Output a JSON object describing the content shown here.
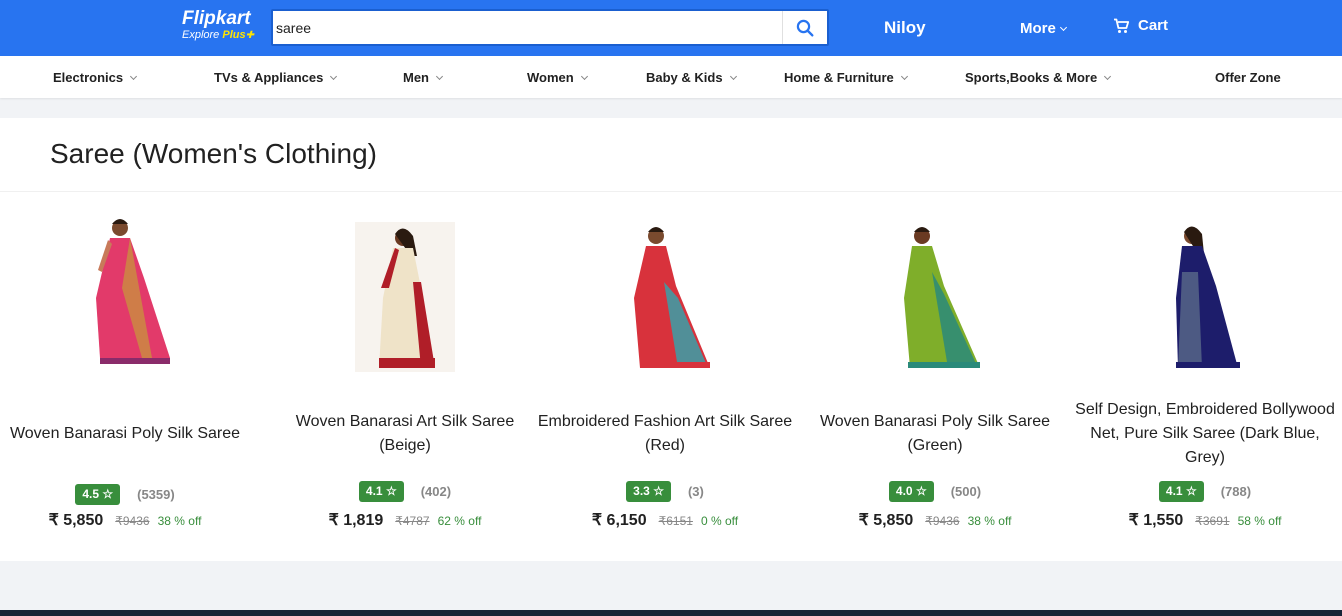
{
  "header": {
    "logo_text": "Flipkart",
    "logo_sub": "Explore",
    "logo_plus": "Plus",
    "search_value": "saree",
    "user": "Niloy",
    "more": "More",
    "cart": "Cart",
    "brand_color": "#2874f0"
  },
  "categories": [
    {
      "label": "Electronics"
    },
    {
      "label": "TVs & Appliances"
    },
    {
      "label": "Men"
    },
    {
      "label": "Women"
    },
    {
      "label": "Baby & Kids"
    },
    {
      "label": "Home & Furniture"
    },
    {
      "label": "Sports,Books & More"
    },
    {
      "label": "Offer Zone"
    }
  ],
  "section": {
    "title": "Saree (Women's Clothing)"
  },
  "products": [
    {
      "name": "Woven Banarasi Poly Silk Saree",
      "rating": "4.5",
      "reviews": "(5359)",
      "price": "₹ 5,850",
      "mrp": "₹9436",
      "off": "38 % off",
      "color": "#e23a6a"
    },
    {
      "name": "Woven Banarasi Art Silk Saree (Beige)",
      "rating": "4.1",
      "reviews": "(402)",
      "price": "₹ 1,819",
      "mrp": "₹4787",
      "off": "62 % off",
      "color": "#efe3c8"
    },
    {
      "name": "Embroidered Fashion Art Silk Saree (Red)",
      "rating": "3.3",
      "reviews": "(3)",
      "price": "₹ 6,150",
      "mrp": "₹6151",
      "off": "0 % off",
      "color": "#d8323c"
    },
    {
      "name": "Woven Banarasi Poly Silk Saree (Green)",
      "rating": "4.0",
      "reviews": "(500)",
      "price": "₹ 5,850",
      "mrp": "₹9436",
      "off": "38 % off",
      "color": "#7fae2a"
    },
    {
      "name": "Self Design, Embroidered Bollywood Net, Pure Silk Saree (Dark Blue, Grey)",
      "rating": "4.1",
      "reviews": "(788)",
      "price": "₹ 1,550",
      "mrp": "₹3691",
      "off": "58 % off",
      "color": "#1d1d6b"
    }
  ]
}
